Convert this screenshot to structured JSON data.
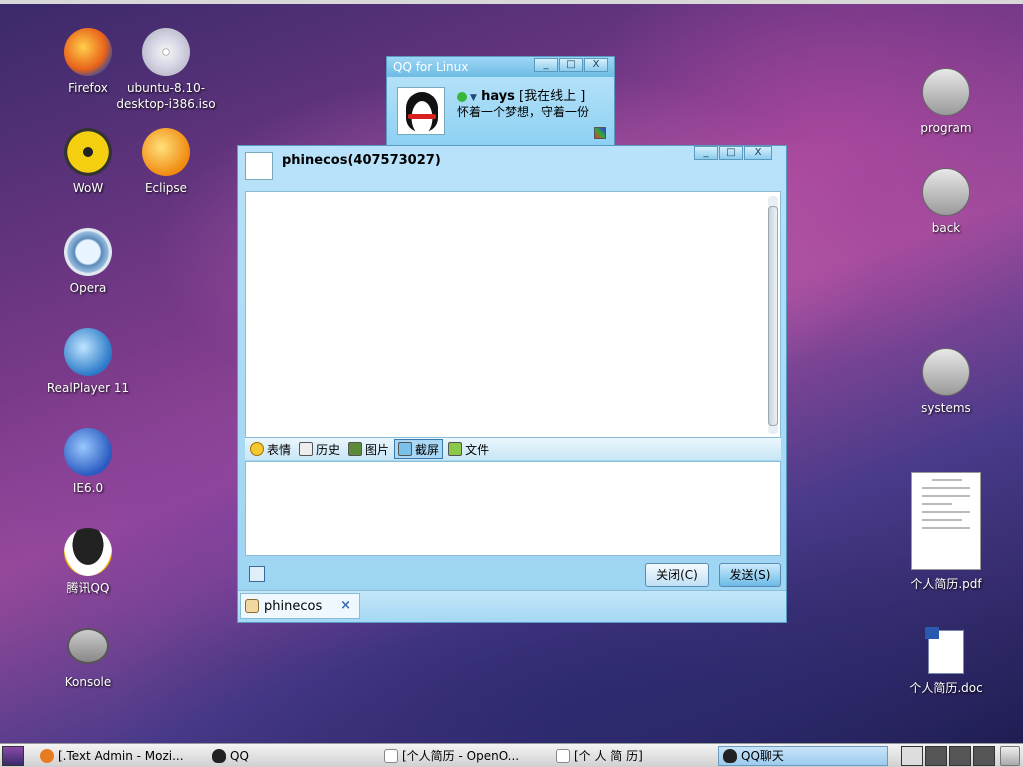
{
  "desktop": {
    "left_icons": [
      {
        "label": "Firefox",
        "icon": "firefox-icon"
      },
      {
        "label": "ubuntu-8.10-\ndesktop-i386.iso",
        "icon": "cd-image-icon"
      },
      {
        "label": "WoW",
        "icon": "wow-icon"
      },
      {
        "label": "Eclipse",
        "icon": "eclipse-icon"
      },
      {
        "label": "Opera",
        "icon": "opera-icon"
      },
      {
        "label": "RealPlayer 11",
        "icon": "realplayer-icon"
      },
      {
        "label": "IE6.0",
        "icon": "ie-icon"
      },
      {
        "label": "腾讯QQ",
        "icon": "qq-icon"
      },
      {
        "label": "Konsole",
        "icon": "konsole-icon"
      }
    ],
    "right_icons": [
      {
        "label": "program",
        "icon": "disk-icon"
      },
      {
        "label": "back",
        "icon": "disk-icon"
      },
      {
        "label": "systems",
        "icon": "disk-icon"
      },
      {
        "label": "个人简历.pdf",
        "icon": "pdf-document-icon"
      },
      {
        "label": "个人简历.doc",
        "icon": "word-document-icon"
      }
    ]
  },
  "qq_mini": {
    "title": "QQ for Linux",
    "name": "hays",
    "status": "[我在线上 ]",
    "signature": "怀着一个梦想，守着一份"
  },
  "chat": {
    "title": "phinecos(407573027)",
    "toolbar": {
      "emoticon": "表情",
      "history": "历史",
      "picture": "图片",
      "screenshot": "截屏",
      "file": "文件"
    },
    "close_label": "关闭(C)",
    "send_label": "发送(S)",
    "tab_label": "phinecos",
    "tab_close": "×"
  },
  "window_buttons": {
    "minimize": "_",
    "maximize": "□",
    "close": "X"
  },
  "taskbar": {
    "items": [
      {
        "label": "[.Text Admin - Mozi...",
        "icon": "firefox-icon"
      },
      {
        "label": "QQ",
        "icon": "qq-icon"
      },
      {
        "label": "[个人简历 - OpenO...",
        "icon": "document-icon"
      },
      {
        "label": "[个 人 简 历]",
        "icon": "document-icon"
      },
      {
        "label": "QQ聊天",
        "icon": "qq-icon"
      }
    ]
  }
}
